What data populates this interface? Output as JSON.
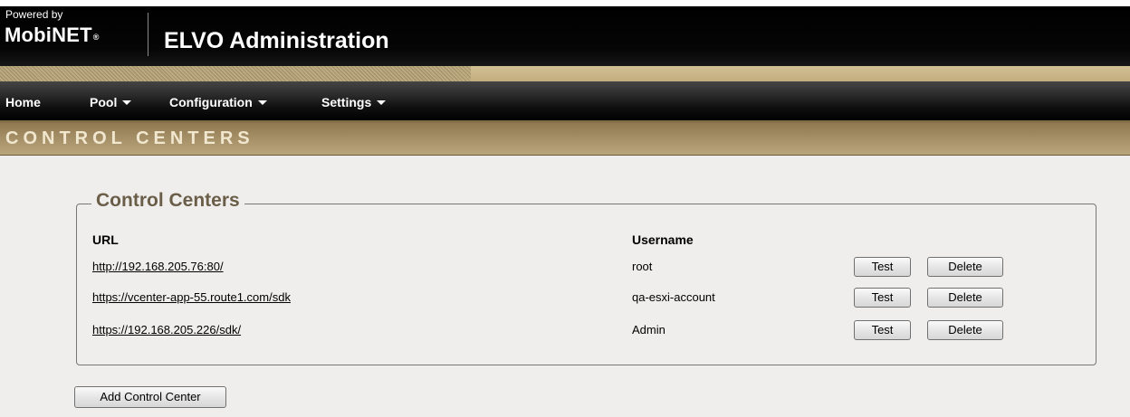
{
  "header": {
    "powered_by": "Powered by",
    "brand": "MobiNET",
    "brand_mark": "®",
    "title": "ELVO Administration"
  },
  "nav": {
    "items": [
      {
        "label": "Home",
        "has_dropdown": false
      },
      {
        "label": "Pool",
        "has_dropdown": true
      },
      {
        "label": "Configuration",
        "has_dropdown": true
      },
      {
        "label": "Settings",
        "has_dropdown": true
      }
    ]
  },
  "section": {
    "title": "CONTROL CENTERS"
  },
  "control_centers": {
    "legend": "Control Centers",
    "columns": {
      "url": "URL",
      "username": "Username"
    },
    "rows": [
      {
        "url": "http://192.168.205.76:80/",
        "username": "root",
        "test_label": "Test",
        "delete_label": "Delete"
      },
      {
        "url": "https://vcenter-app-55.route1.com/sdk",
        "username": "qa-esxi-account",
        "test_label": "Test",
        "delete_label": "Delete"
      },
      {
        "url": "https://192.168.205.226/sdk/",
        "username": "Admin",
        "test_label": "Test",
        "delete_label": "Delete"
      }
    ],
    "add_button_label": "Add Control Center"
  },
  "colors": {
    "header_bg": "#000000",
    "tan_accent": "#c3ad7d",
    "section_band": "#a48e66",
    "legend_text": "#6b5e49",
    "page_bg": "#efeeed"
  }
}
